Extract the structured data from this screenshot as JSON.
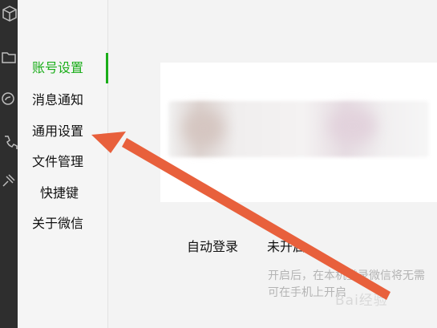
{
  "menu": {
    "items": [
      {
        "label": "账号设置",
        "active": true
      },
      {
        "label": "消息通知",
        "active": false
      },
      {
        "label": "通用设置",
        "active": false
      },
      {
        "label": "文件管理",
        "active": false
      },
      {
        "label": "快捷键",
        "active": false
      },
      {
        "label": "关于微信",
        "active": false
      }
    ]
  },
  "auto_login": {
    "label": "自动登录",
    "status": "未开启"
  },
  "hint": {
    "line1": "开启后，在本机登录微信将无需",
    "line2": "可在手机上开启"
  },
  "watermark": "Bai经验",
  "colors": {
    "accent": "#1aad19",
    "annotation_arrow": "#e8603c",
    "sidebar_dark": "#2e2e2e"
  },
  "icons": [
    "box-icon",
    "folder-icon",
    "miniprogram-icon",
    "phone-icon",
    "pin-icon"
  ]
}
